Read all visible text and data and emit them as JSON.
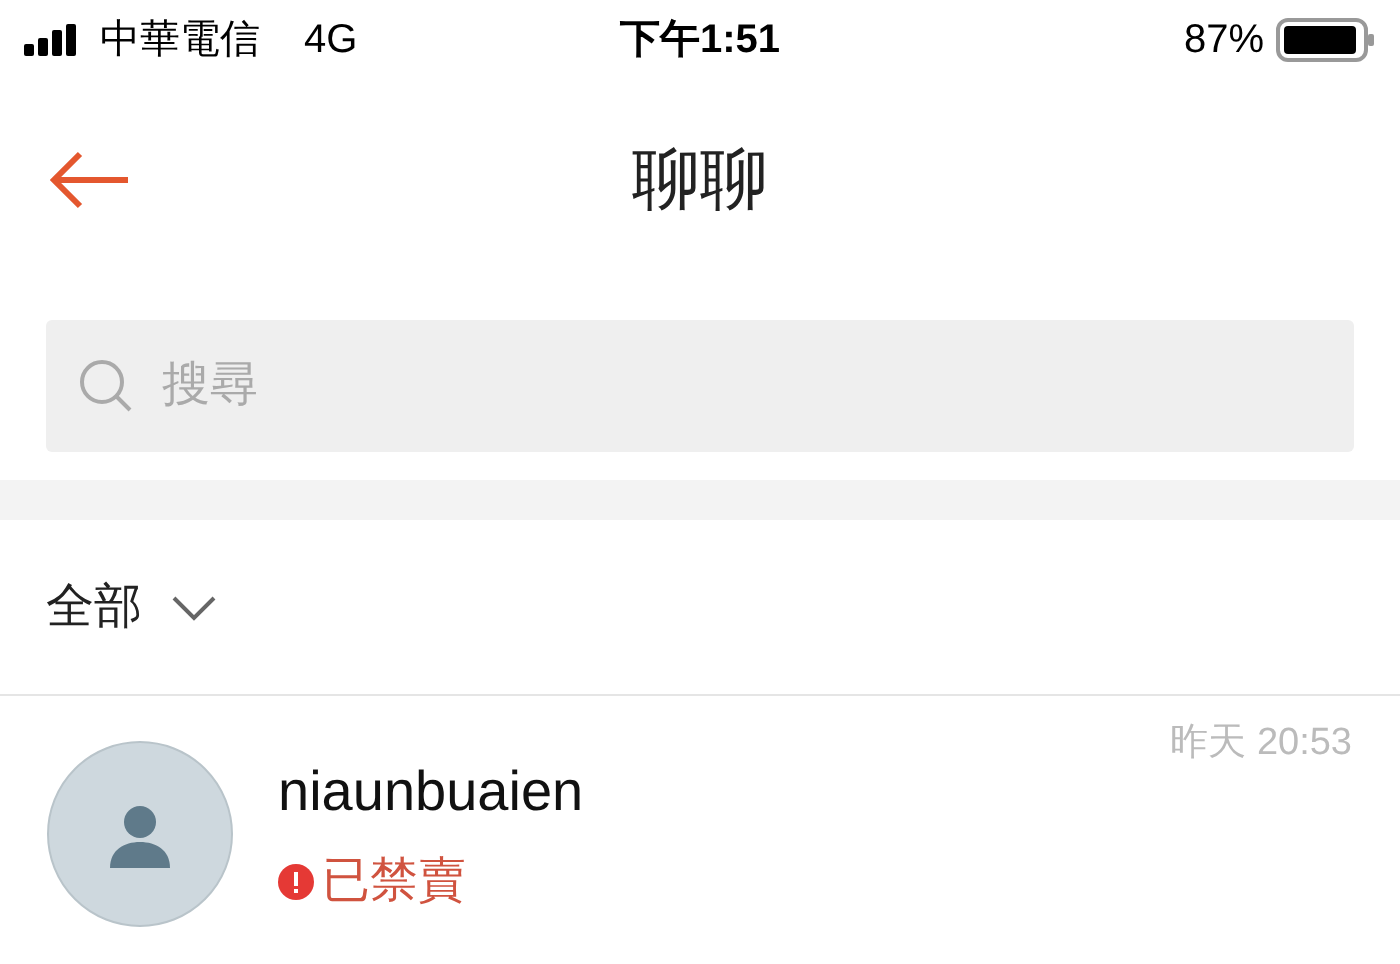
{
  "status_bar": {
    "carrier": "中華電信",
    "network": "4G",
    "time": "下午1:51",
    "battery": "87%"
  },
  "header": {
    "title": "聊聊"
  },
  "search": {
    "placeholder": "搜尋"
  },
  "filter": {
    "label": "全部"
  },
  "chats": [
    {
      "name": "niaunbuaien",
      "time": "昨天 20:53",
      "status": {
        "kind": "banned",
        "text": "已禁賣"
      }
    }
  ]
}
